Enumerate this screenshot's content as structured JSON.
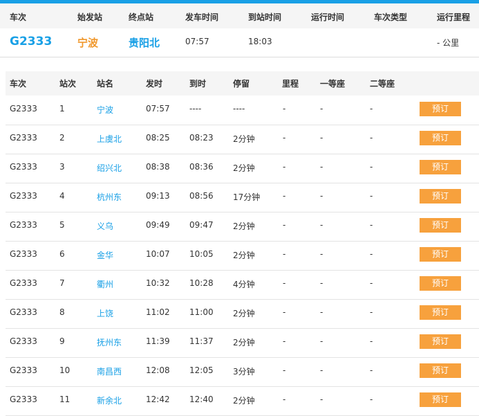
{
  "summary": {
    "headers": [
      "车次",
      "始发站",
      "终点站",
      "发车时间",
      "到站时间",
      "运行时间",
      "车次类型",
      "运行里程"
    ],
    "train": "G2333",
    "from": "宁波",
    "to": "贵阳北",
    "depart": "07:57",
    "arrive": "18:03",
    "duration": "",
    "type": "",
    "distance": "- 公里"
  },
  "detail": {
    "headers": [
      "车次",
      "站次",
      "站名",
      "发时",
      "到时",
      "停留",
      "里程",
      "一等座",
      "二等座"
    ],
    "book_label": "预订",
    "rows": [
      {
        "train": "G2333",
        "no": "1",
        "station": "宁波",
        "dep": "07:57",
        "arr": "----",
        "stay": "----",
        "km": "-",
        "first": "-",
        "second": "-"
      },
      {
        "train": "G2333",
        "no": "2",
        "station": "上虞北",
        "dep": "08:25",
        "arr": "08:23",
        "stay": "2分钟",
        "km": "-",
        "first": "-",
        "second": "-"
      },
      {
        "train": "G2333",
        "no": "3",
        "station": "绍兴北",
        "dep": "08:38",
        "arr": "08:36",
        "stay": "2分钟",
        "km": "-",
        "first": "-",
        "second": "-"
      },
      {
        "train": "G2333",
        "no": "4",
        "station": "杭州东",
        "dep": "09:13",
        "arr": "08:56",
        "stay": "17分钟",
        "km": "-",
        "first": "-",
        "second": "-"
      },
      {
        "train": "G2333",
        "no": "5",
        "station": "义乌",
        "dep": "09:49",
        "arr": "09:47",
        "stay": "2分钟",
        "km": "-",
        "first": "-",
        "second": "-"
      },
      {
        "train": "G2333",
        "no": "6",
        "station": "金华",
        "dep": "10:07",
        "arr": "10:05",
        "stay": "2分钟",
        "km": "-",
        "first": "-",
        "second": "-"
      },
      {
        "train": "G2333",
        "no": "7",
        "station": "衢州",
        "dep": "10:32",
        "arr": "10:28",
        "stay": "4分钟",
        "km": "-",
        "first": "-",
        "second": "-"
      },
      {
        "train": "G2333",
        "no": "8",
        "station": "上饶",
        "dep": "11:02",
        "arr": "11:00",
        "stay": "2分钟",
        "km": "-",
        "first": "-",
        "second": "-"
      },
      {
        "train": "G2333",
        "no": "9",
        "station": "抚州东",
        "dep": "11:39",
        "arr": "11:37",
        "stay": "2分钟",
        "km": "-",
        "first": "-",
        "second": "-"
      },
      {
        "train": "G2333",
        "no": "10",
        "station": "南昌西",
        "dep": "12:08",
        "arr": "12:05",
        "stay": "3分钟",
        "km": "-",
        "first": "-",
        "second": "-"
      },
      {
        "train": "G2333",
        "no": "11",
        "station": "新余北",
        "dep": "12:42",
        "arr": "12:40",
        "stay": "2分钟",
        "km": "-",
        "first": "-",
        "second": "-"
      }
    ]
  },
  "colors": {
    "accent": "#19a0e6",
    "origin": "#f0982d",
    "button": "#f7a13d"
  }
}
